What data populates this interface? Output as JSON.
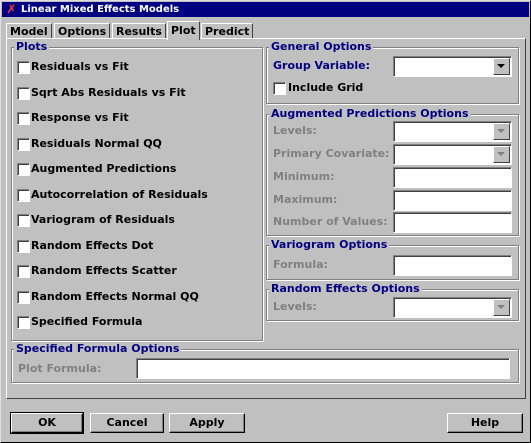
{
  "window": {
    "title": "Linear Mixed Effects Models",
    "icon": "app-icon"
  },
  "tabs": [
    "Model",
    "Options",
    "Results",
    "Plot",
    "Predict"
  ],
  "active_tab": "Plot",
  "plots": {
    "title": "Plots",
    "items": [
      "Residuals vs Fit",
      "Sqrt Abs Residuals vs Fit",
      "Response vs Fit",
      "Residuals Normal QQ",
      "Augmented Predictions",
      "Autocorrelation of Residuals",
      "Variogram of Residuals",
      "Random Effects Dot",
      "Random Effects Scatter",
      "Random Effects Normal QQ",
      "Specified Formula"
    ]
  },
  "general": {
    "title": "General Options",
    "group_variable_label": "Group Variable:",
    "group_variable_value": "",
    "include_grid_label": "Include Grid"
  },
  "augmented": {
    "title": "Augmented Predictions Options",
    "levels_label": "Levels:",
    "primary_covariate_label": "Primary Covariate:",
    "minimum_label": "Minimum:",
    "maximum_label": "Maximum:",
    "number_of_values_label": "Number of Values:"
  },
  "variogram": {
    "title": "Variogram Options",
    "formula_label": "Formula:"
  },
  "random_effects": {
    "title": "Random Effects Options",
    "levels_label": "Levels:"
  },
  "specified": {
    "title": "Specified Formula Options",
    "plot_formula_label": "Plot Formula:"
  },
  "buttons": {
    "ok": "OK",
    "cancel": "Cancel",
    "apply": "Apply",
    "help": "Help"
  },
  "colors": {
    "titlebar": "#000080",
    "face": "#c0c0c0",
    "group_title": "#000080",
    "disabled_text": "#808080"
  }
}
